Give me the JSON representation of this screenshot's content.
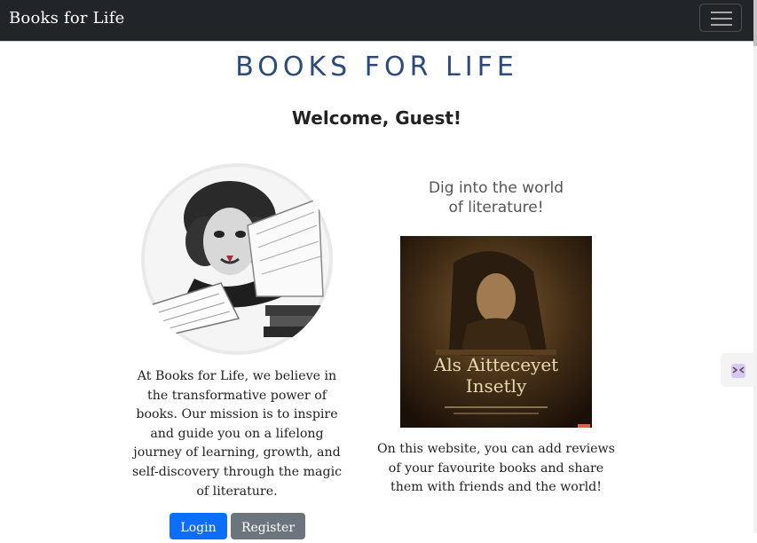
{
  "navbar": {
    "brand": "Books for Life",
    "toggle_icon": "hamburger-menu-icon"
  },
  "header": {
    "title": "BOOKS FOR LIFE",
    "welcome": "Welcome, Guest!"
  },
  "left": {
    "image_icon": "shakespeare-portrait-illustration",
    "mission_text": "At Books for Life, we believe in the transformative power of books. Our mission is to inspire and guide you on a lifelong journey of learning, growth, and self-discovery through the magic of literature.",
    "login_label": "Login",
    "register_label": "Register"
  },
  "right": {
    "tagline_line1": "Dig into the world",
    "tagline_line2": "of literature!",
    "book_cover_text1": "Als Aitteceyet",
    "book_cover_text2": "Insetly",
    "description": "On this website, you can add reviews of your favourite books and share them with friends and the world!"
  },
  "colors": {
    "navbar_bg": "#212529",
    "title_blue": "#2c4a7c",
    "login_blue": "#0d6efd",
    "register_gray": "#6c757d"
  }
}
